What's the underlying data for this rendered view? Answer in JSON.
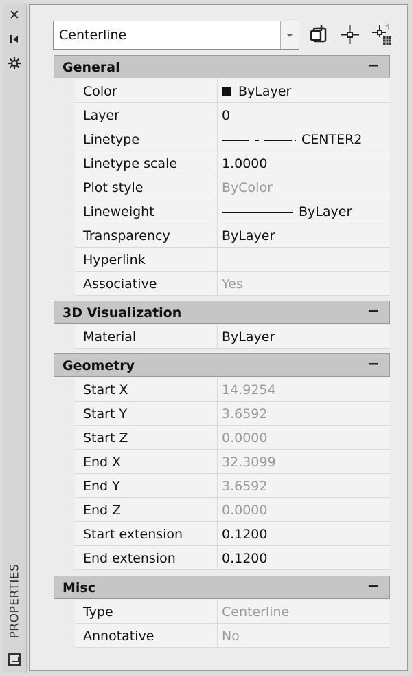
{
  "panel_title": "PROPERTIES",
  "object_selector": {
    "value": "Centerline"
  },
  "sections": {
    "general": {
      "title": "General",
      "collapse": "−",
      "rows": [
        {
          "label": "Color",
          "value": "ByLayer",
          "disabled": false
        },
        {
          "label": "Layer",
          "value": "0",
          "disabled": false
        },
        {
          "label": "Linetype",
          "value": "CENTER2",
          "disabled": false
        },
        {
          "label": "Linetype scale",
          "value": "1.0000",
          "disabled": false
        },
        {
          "label": "Plot style",
          "value": "ByColor",
          "disabled": true
        },
        {
          "label": "Lineweight",
          "value": "ByLayer",
          "disabled": false
        },
        {
          "label": "Transparency",
          "value": "ByLayer",
          "disabled": false
        },
        {
          "label": "Hyperlink",
          "value": "",
          "disabled": false
        },
        {
          "label": "Associative",
          "value": "Yes",
          "disabled": true
        }
      ]
    },
    "visualization": {
      "title": "3D Visualization",
      "collapse": "−",
      "rows": [
        {
          "label": "Material",
          "value": "ByLayer",
          "disabled": false
        }
      ]
    },
    "geometry": {
      "title": "Geometry",
      "collapse": "−",
      "rows": [
        {
          "label": "Start X",
          "value": "14.9254",
          "disabled": true
        },
        {
          "label": "Start Y",
          "value": "3.6592",
          "disabled": true
        },
        {
          "label": "Start Z",
          "value": "0.0000",
          "disabled": true
        },
        {
          "label": "End X",
          "value": "32.3099",
          "disabled": true
        },
        {
          "label": "End Y",
          "value": "3.6592",
          "disabled": true
        },
        {
          "label": "End Z",
          "value": "0.0000",
          "disabled": true
        },
        {
          "label": "Start extension",
          "value": "0.1200",
          "disabled": false
        },
        {
          "label": "End extension",
          "value": "0.1200",
          "disabled": false
        }
      ]
    },
    "misc": {
      "title": "Misc",
      "collapse": "−",
      "rows": [
        {
          "label": "Type",
          "value": "Centerline",
          "disabled": true
        },
        {
          "label": "Annotative",
          "value": "No",
          "disabled": true
        }
      ]
    }
  },
  "icons": {
    "strip": [
      "close-icon",
      "auto-hide-icon",
      "settings-icon",
      "properties-palette-icon"
    ],
    "toolbar": [
      "toggle-pickadd-icon",
      "select-objects-icon",
      "quick-select-icon"
    ]
  }
}
